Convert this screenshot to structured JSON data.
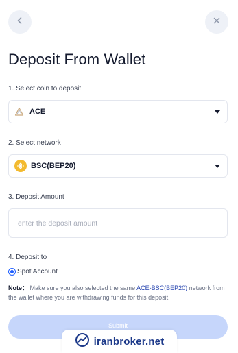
{
  "header": {
    "back_icon": "chevron-left-icon",
    "close_icon": "close-icon"
  },
  "title": "Deposit From Wallet",
  "coin": {
    "label": "1. Select coin to deposit",
    "value": "ACE",
    "icon": "ace-coin-icon"
  },
  "network": {
    "label": "2. Select network",
    "value": "BSC(BEP20)",
    "icon": "bnb-chain-icon",
    "icon_color": "#f3ba2f"
  },
  "amount": {
    "label": "3. Deposit Amount",
    "placeholder": "enter the deposit amount",
    "value": ""
  },
  "deposit_to": {
    "label": "4. Deposit to",
    "option": "Spot Account",
    "selected": true
  },
  "note": {
    "title": "Note：",
    "before": " Make sure you also selected the same ",
    "pair": "ACE-BSC(BEP20)",
    "after": " network from the wallet where you are withdrawing funds for this deposit."
  },
  "submit_label": "Submit",
  "watermark": {
    "text": "iranbroker.net",
    "icon": "trend-chart-icon"
  },
  "colors": {
    "accent": "#1e5eff",
    "submit_disabled": "#c6d6fb",
    "pair_link": "#2745b0"
  }
}
